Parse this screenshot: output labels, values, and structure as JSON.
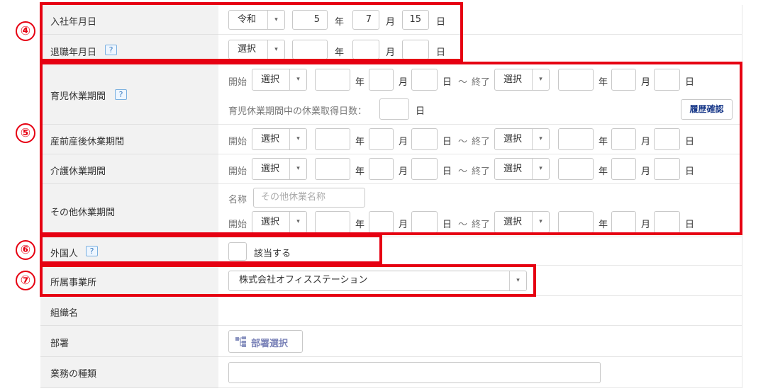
{
  "labels": {
    "hire_date": "入社年月日",
    "retire_date": "退職年月日",
    "childcare_leave": "育児休業期間",
    "maternity_leave": "産前産後休業期間",
    "nursing_leave": "介護休業期間",
    "other_leave": "その他休業期間",
    "foreigner": "外国人",
    "office": "所属事業所",
    "organization": "組織名",
    "department": "部署",
    "job_type": "業務の種類"
  },
  "help_mark": "?",
  "units": {
    "year": "年",
    "month": "月",
    "day": "日",
    "tilde": "〜",
    "start": "開始",
    "end": "終了",
    "name": "名称"
  },
  "hire_date": {
    "era": "令和",
    "year": "5",
    "month": "7",
    "day": "15"
  },
  "retire_date": {
    "era": "選択",
    "year": "",
    "month": "",
    "day": ""
  },
  "select_default": "選択",
  "childcare": {
    "days_label": "育児休業期間中の休業取得日数：",
    "days_value": "",
    "history_button": "履歴確認"
  },
  "other_leave_name_placeholder": "その他休業名称",
  "foreigner_checkbox_label": "該当する",
  "office_value": "株式会社オフィスステーション",
  "department_button": "部署選択",
  "annotations": [
    "④",
    "⑤",
    "⑥",
    "⑦"
  ],
  "colors": {
    "highlight": "#e60012",
    "label_bg": "#f2f2f2",
    "button_text": "#1a3a8a"
  }
}
